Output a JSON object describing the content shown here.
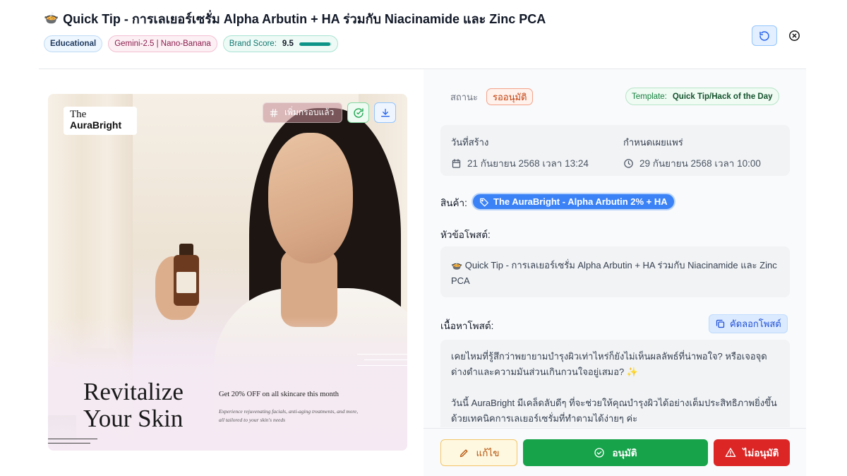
{
  "header": {
    "title_emoji": "🍲",
    "title": "Quick Tip - การเลเยอร์เซรั่ม Alpha Arbutin + HA ร่วมกับ Niacinamide และ Zinc PCA",
    "badges": {
      "type": "Educational",
      "model": "Gemini-2.5 | Nano-Banana",
      "score_label": "Brand Score:",
      "score_value": "9.5",
      "score_fraction": 0.95
    },
    "refresh_icon": "refresh-icon",
    "close_icon": "close-circle-icon"
  },
  "image_panel": {
    "brand_line1": "The",
    "brand_line2": "AuraBright",
    "crop_label": "เพิ่มกรอบแล้ว",
    "headline_line1": "Revitalize",
    "headline_line2": "Your Skin",
    "offer": "Get 20% OFF on all skincare this month",
    "offer_sub": "Experience rejuvenating facials, anti-aging treatments, and more, all tailored to your skin's needs"
  },
  "details": {
    "status_label": "สถานะ",
    "status_value": "รออนุมัติ",
    "template_label": "Template:",
    "template_value": "Quick Tip/Hack of the Day",
    "created_label": "วันที่สร้าง",
    "created_value": "21 กันยายน 2568 เวลา 13:24",
    "publish_label": "กำหนดเผยแพร่",
    "publish_value": "29 กันยายน 2568 เวลา 10:00",
    "product_label": "สินค้า:",
    "product_value": "The AuraBright - Alpha Arbutin 2% + HA",
    "topic_label": "หัวข้อโพสต์:",
    "topic_value": "🍲 Quick Tip - การเลเยอร์เซรั่ม Alpha Arbutin + HA ร่วมกับ Niacinamide และ Zinc PCA",
    "content_label": "เนื้อหาโพสต์:",
    "copy_label": "คัดลอกโพสต์",
    "content_value": "เคยไหมที่รู้สึกว่าพยายามบำรุงผิวเท่าไหร่ก็ยังไม่เห็นผลลัพธ์ที่น่าพอใจ? หรือเจอจุดด่างดำและความมันส่วนเกินกวนใจอยู่เสมอ? ✨\n\nวันนี้ AuraBright มีเคล็ดลับดีๆ ที่จะช่วยให้คุณบำรุงผิวได้อย่างเต็มประสิทธิภาพยิ่งขึ้นด้วยเทคนิคการเลเยอร์เซรั่มที่ทำตามได้ง่ายๆ ค่ะ"
  },
  "actions": {
    "edit": "แก้ไข",
    "approve": "อนุมัติ",
    "reject": "ไม่อนุมัติ"
  },
  "colors": {
    "approve": "#16a34a",
    "reject": "#dc2626",
    "accent": "#3b82f6"
  }
}
